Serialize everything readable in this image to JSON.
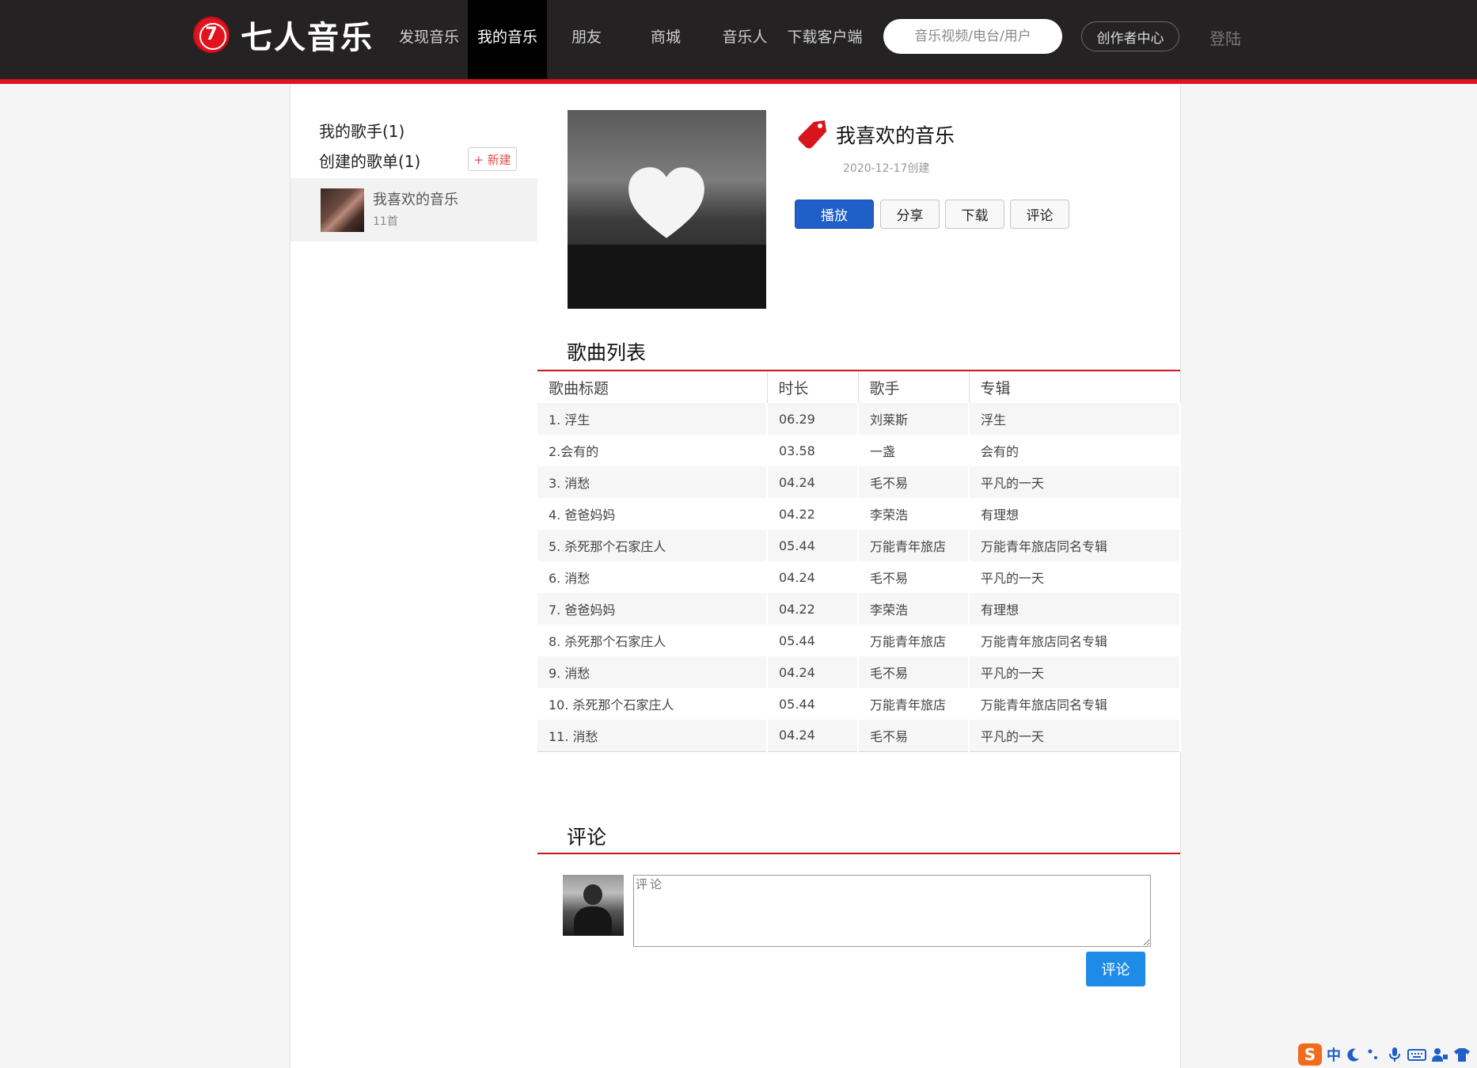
{
  "header": {
    "logo_mark": "7",
    "logo_text": "七人音乐",
    "nav": [
      "发现音乐",
      "我的音乐",
      "朋友",
      "商城",
      "音乐人",
      "下载客户端"
    ],
    "search_placeholder": "音乐视频/电台/用户",
    "creator_label": "创作者中心",
    "login_label": "登陆",
    "accent": "#e2131f"
  },
  "sidebar": {
    "singers_label": "我的歌手(1)",
    "created_label": "创建的歌单(1)",
    "new_button": "+ 新建",
    "playlist": {
      "name": "我喜欢的音乐",
      "count": "11首"
    }
  },
  "playlist": {
    "title": "我喜欢的音乐",
    "created": "2020-12-17创建",
    "buttons": {
      "play": "播放",
      "share": "分享",
      "download": "下载",
      "comment": "评论"
    },
    "play_color": "#1f5fc7"
  },
  "songs": {
    "heading": "歌曲列表",
    "columns": [
      "歌曲标题",
      "时长",
      "歌手",
      "专辑"
    ],
    "rows": [
      [
        "1. 浮生",
        "06.29",
        "刘莱斯",
        "浮生"
      ],
      [
        "2.会有的",
        "03.58",
        "一盏",
        "会有的"
      ],
      [
        "3. 消愁",
        "04.24",
        "毛不易",
        "平凡的一天"
      ],
      [
        "4. 爸爸妈妈",
        "04.22",
        "李荣浩",
        "有理想"
      ],
      [
        "5. 杀死那个石家庄人",
        "05.44",
        "万能青年旅店",
        "万能青年旅店同名专辑"
      ],
      [
        "6. 消愁",
        "04.24",
        "毛不易",
        "平凡的一天"
      ],
      [
        "7. 爸爸妈妈",
        "04.22",
        "李荣浩",
        "有理想"
      ],
      [
        "8. 杀死那个石家庄人",
        "05.44",
        "万能青年旅店",
        "万能青年旅店同名专辑"
      ],
      [
        "9. 消愁",
        "04.24",
        "毛不易",
        "平凡的一天"
      ],
      [
        "10. 杀死那个石家庄人",
        "05.44",
        "万能青年旅店",
        "万能青年旅店同名专辑"
      ],
      [
        "11. 消愁",
        "04.24",
        "毛不易",
        "平凡的一天"
      ]
    ]
  },
  "comments": {
    "heading": "评论",
    "placeholder": "评论",
    "submit": "评论",
    "submit_color": "#1e8ce6"
  },
  "ime": {
    "logo": "S",
    "lang": "中"
  }
}
